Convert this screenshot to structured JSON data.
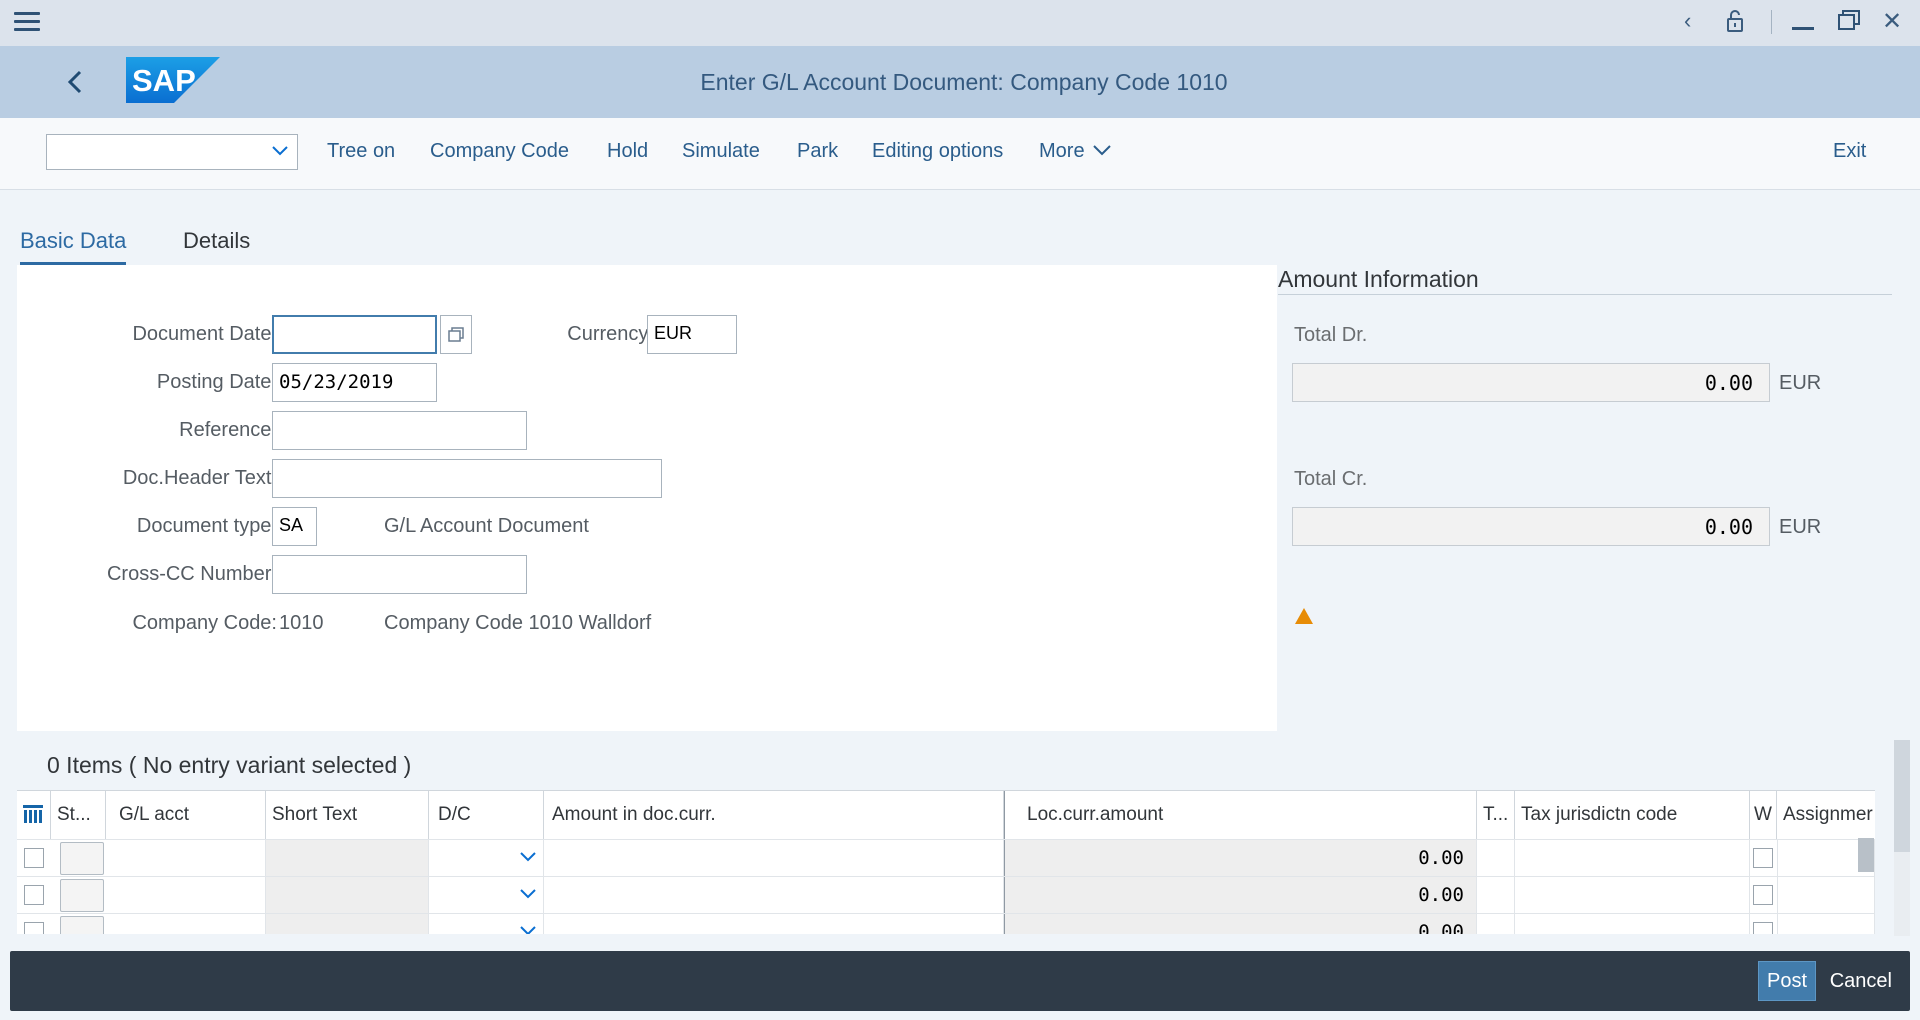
{
  "shell": {
    "title": "Enter G/L Account Document: Company Code 1010",
    "logo_text": "SAP"
  },
  "toolbar": {
    "variant_value": "",
    "items": [
      "Tree on",
      "Company Code",
      "Hold",
      "Simulate",
      "Park",
      "Editing options",
      "More"
    ],
    "exit_label": "Exit"
  },
  "tabs": [
    "Basic Data",
    "Details"
  ],
  "form": {
    "document_date_label": "Document Date:",
    "document_date_value": "",
    "currency_label": "Currency:",
    "currency_value": "EUR",
    "posting_date_label": "Posting Date:",
    "posting_date_value": "05/23/2019",
    "reference_label": "Reference:",
    "reference_value": "",
    "header_text_label": "Doc.Header Text:",
    "header_text_value": "",
    "doc_type_label": "Document type:",
    "doc_type_value": "SA",
    "doc_type_desc": "G/L Account Document",
    "cross_cc_label": "Cross-CC Number:",
    "cross_cc_value": "",
    "company_code_label": "Company Code:",
    "company_code_value": "1010",
    "company_code_desc": "Company Code 1010 Walldorf"
  },
  "amount_info": {
    "title": "Amount Information",
    "total_dr_label": "Total Dr.",
    "total_dr_value": "0.00",
    "total_dr_currency": "EUR",
    "total_cr_label": "Total Cr.",
    "total_cr_value": "0.00",
    "total_cr_currency": "EUR",
    "status_icon": "warning-triangle-icon",
    "warning_color": "#e78c07"
  },
  "items": {
    "title": "0 Items ( No entry variant selected )",
    "columns": [
      "St...",
      "G/L acct",
      "Short Text",
      "D/C",
      "Amount in doc.curr.",
      "Loc.curr.amount",
      "T...",
      "Tax jurisdictn code",
      "W",
      "Assignmer"
    ],
    "rows": [
      {
        "loc_amount": "0.00"
      },
      {
        "loc_amount": "0.00"
      },
      {
        "loc_amount": "0.00"
      }
    ]
  },
  "footer": {
    "post_label": "Post",
    "cancel_label": "Cancel"
  },
  "colors": {
    "shell_bg": "#b9cde2",
    "accent": "#2d6aa3",
    "post_button": "#427cac",
    "footer_bg": "#2f3b48"
  }
}
